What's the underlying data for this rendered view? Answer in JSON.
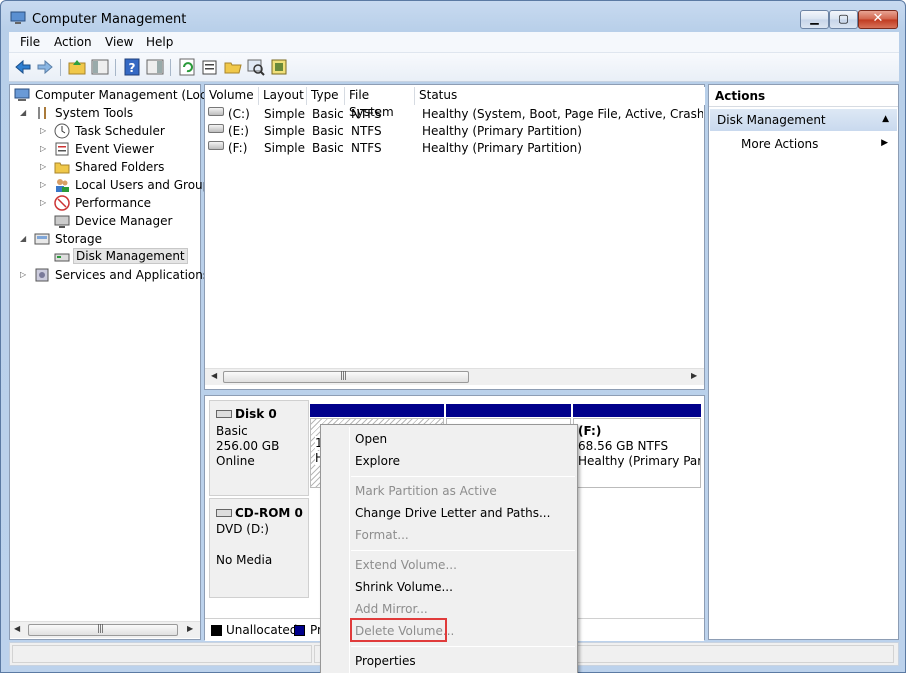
{
  "window": {
    "title": "Computer Management"
  },
  "menu": [
    "File",
    "Action",
    "View",
    "Help"
  ],
  "toolbar": {
    "icons": [
      "back-icon",
      "forward-icon",
      "up-folder-icon",
      "show-hide-tree-icon",
      "help-icon",
      "show-hide-action-pane-icon",
      "refresh-icon",
      "properties-icon",
      "open-folder-icon",
      "search-icon",
      "settings-icon"
    ]
  },
  "tree": {
    "items": [
      {
        "label": "Computer Management (Local"
      },
      {
        "label": "System Tools"
      },
      {
        "label": "Task Scheduler"
      },
      {
        "label": "Event Viewer"
      },
      {
        "label": "Shared Folders"
      },
      {
        "label": "Local Users and Groups"
      },
      {
        "label": "Performance"
      },
      {
        "label": "Device Manager"
      },
      {
        "label": "Storage"
      },
      {
        "label": "Disk Management"
      },
      {
        "label": "Services and Applications"
      }
    ]
  },
  "volumes": {
    "headers": [
      "Volume",
      "Layout",
      "Type",
      "File System",
      "Status"
    ],
    "rows": [
      [
        "(C:)",
        "Simple",
        "Basic",
        "NTFS",
        "Healthy (System, Boot, Page File, Active, Crash Dump"
      ],
      [
        "(E:)",
        "Simple",
        "Basic",
        "NTFS",
        "Healthy (Primary Partition)"
      ],
      [
        "(F:)",
        "Simple",
        "Basic",
        "NTFS",
        "Healthy (Primary Partition)"
      ]
    ]
  },
  "disks": {
    "disk0": {
      "name": "Disk 0",
      "type": "Basic",
      "size": "256.00 GB",
      "state": "Online"
    },
    "cdrom0": {
      "name": "CD-ROM 0",
      "type": "DVD (D:)",
      "state": "No Media"
    },
    "partitions": [
      {
        "line1": "1",
        "line2": "H"
      },
      {
        "line1": "",
        "line2": ""
      },
      {
        "line1": "(F:)",
        "line2": "68.56 GB NTFS",
        "line3": "Healthy (Primary Part"
      }
    ],
    "legend": [
      {
        "label": "Unallocated",
        "color": "#000000"
      },
      {
        "label": "Pr",
        "color": "#00008b"
      }
    ]
  },
  "actions": {
    "title": "Actions",
    "section": "Disk Management",
    "more": "More Actions"
  },
  "context_menu": {
    "items": [
      {
        "label": "Open",
        "enabled": true
      },
      {
        "label": "Explore",
        "enabled": true
      },
      {
        "label": "Mark Partition as Active",
        "enabled": false
      },
      {
        "label": "Change Drive Letter and Paths...",
        "enabled": true
      },
      {
        "label": "Format...",
        "enabled": false
      },
      {
        "label": "Extend Volume...",
        "enabled": false
      },
      {
        "label": "Shrink Volume...",
        "enabled": true
      },
      {
        "label": "Add Mirror...",
        "enabled": false
      },
      {
        "label": "Delete Volume...",
        "enabled": false
      },
      {
        "label": "Properties",
        "enabled": true
      }
    ]
  },
  "colors": {
    "partition_bar": "#00008b",
    "highlight": "#e03b3b"
  }
}
